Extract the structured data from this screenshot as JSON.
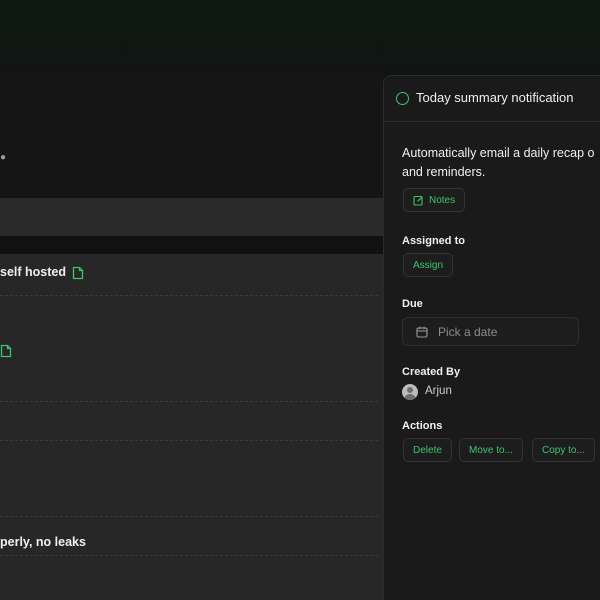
{
  "board": {
    "tasks": [
      {
        "text": "self hosted"
      },
      {
        "text": ""
      },
      {
        "text": "perly, no leaks"
      }
    ]
  },
  "panel": {
    "title": "Today summary notification",
    "description_line1": "Automatically email a daily recap o",
    "description_line2": "and reminders.",
    "notes_label": "Notes",
    "assigned_label": "Assigned to",
    "assign_button": "Assign",
    "due_label": "Due",
    "date_placeholder": "Pick a date",
    "created_label": "Created By",
    "creator_name": "Arjun",
    "actions_label": "Actions",
    "actions": {
      "delete": "Delete",
      "move": "Move to...",
      "copy": "Copy to..."
    }
  },
  "colors": {
    "accent": "#3ec46d",
    "panel_bg": "#1a1a1a",
    "board_bg": "#272727"
  },
  "icons": [
    "status-circle-icon",
    "document-icon",
    "edit-icon",
    "calendar-icon",
    "avatar"
  ]
}
